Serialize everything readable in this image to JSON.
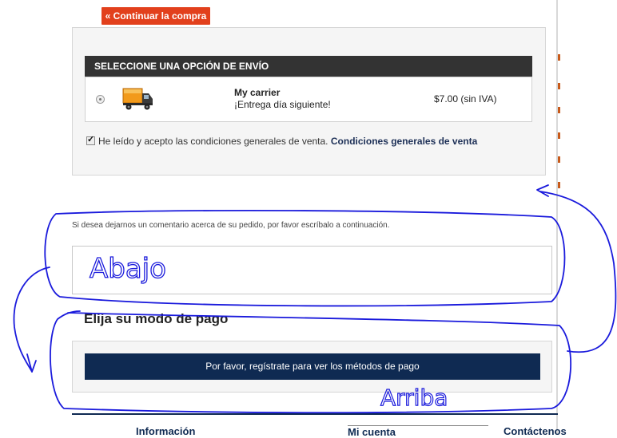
{
  "actions": {
    "continue_shopping": "« Continuar la compra"
  },
  "shipping": {
    "header": "SELECCIONE UNA OPCIÓN DE ENVÍO",
    "carrier": {
      "name": "My carrier",
      "delay": "¡Entrega día siguiente!",
      "price": "$7.00 (sin IVA)",
      "icon": "truck-icon",
      "selected": true
    },
    "terms_text": "He leído y acepto las condiciones generales de venta.",
    "terms_link": "Condiciones generales de venta",
    "terms_checked": true
  },
  "comment": {
    "label": "Si desea dejarnos un comentario acerca de su pedido, por favor escríbalo a continuación.",
    "value": ""
  },
  "payment": {
    "title": "Elija su modo de pago",
    "button": "Por favor, regístrate para ver los métodos de pago"
  },
  "footer": {
    "info": "Información",
    "account": "Mi cuenta",
    "contact": "Contáctenos"
  },
  "annotations": {
    "down": "Abajo",
    "up": "Arriba",
    "color": "#1a1adc"
  },
  "colors": {
    "accent_red": "#e2401c",
    "navy": "#0f2a52",
    "header_dark": "#333333"
  }
}
